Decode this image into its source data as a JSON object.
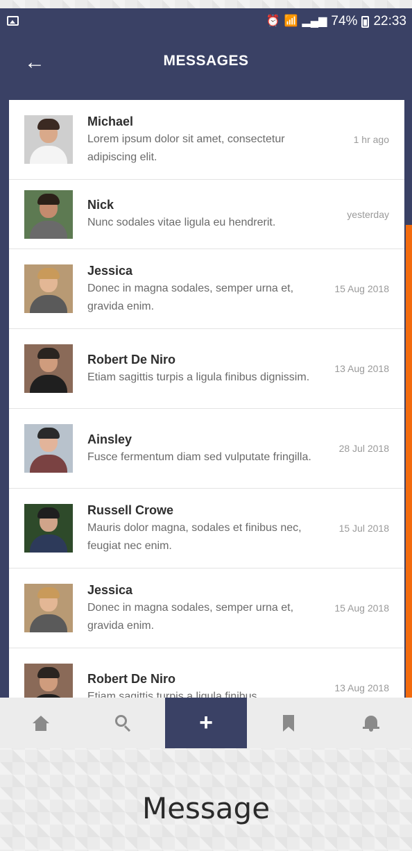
{
  "status_bar": {
    "icons": [
      "image-icon",
      "alarm-icon",
      "wifi-icon",
      "sim-icon",
      "signal-icon",
      "battery-icon"
    ],
    "battery": "74%",
    "time": "22:33"
  },
  "header": {
    "title": "MESSAGES",
    "back_icon": "arrow-left-icon"
  },
  "colors": {
    "primary": "#3a4165",
    "accent": "#f26b0f"
  },
  "messages": [
    {
      "name": "Michael",
      "preview": "Lorem ipsum dolor sit amet, consectetur adipiscing elit.",
      "time": "1 hr ago"
    },
    {
      "name": "Nick",
      "preview": "Nunc sodales vitae ligula eu hendrerit.",
      "time": "yesterday"
    },
    {
      "name": "Jessica",
      "preview": "Donec in magna sodales, semper urna et, gravida enim.",
      "time": "15 Aug 2018"
    },
    {
      "name": "Robert De Niro",
      "preview": "Etiam sagittis turpis a ligula finibus dignissim.",
      "time": "13 Aug 2018"
    },
    {
      "name": "Ainsley",
      "preview": "Fusce fermentum diam sed vulputate fringilla.",
      "time": "28 Jul 2018"
    },
    {
      "name": "Russell Crowe",
      "preview": "Mauris dolor magna, sodales et finibus nec, feugiat nec enim.",
      "time": "15 Jul 2018"
    },
    {
      "name": "Jessica",
      "preview": "Donec in magna sodales, semper urna et, gravida enim.",
      "time": "15 Aug 2018"
    },
    {
      "name": "Robert De Niro",
      "preview": "Etiam sagittis turpis a ligula finibus",
      "time": "13 Aug 2018"
    }
  ],
  "bottom_nav": {
    "items": [
      "home-icon",
      "search-icon",
      "plus-icon",
      "bookmark-icon",
      "bell-icon"
    ],
    "active_label": "+"
  },
  "caption": "Message"
}
